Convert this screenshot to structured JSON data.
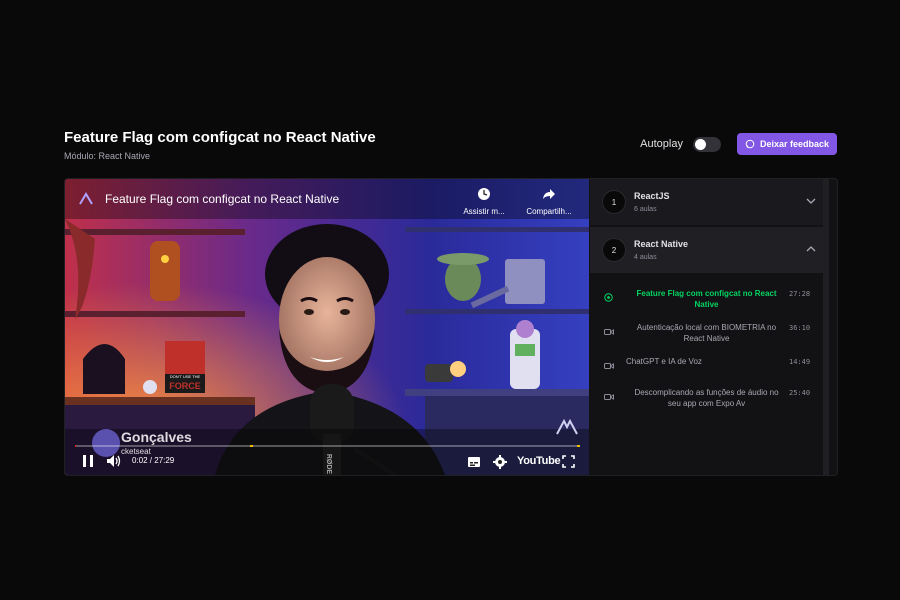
{
  "header": {
    "title": "Feature Flag com configcat no React Native",
    "subtitle": "Módulo: React Native",
    "autoplay_label": "Autoplay",
    "autoplay_on": false,
    "feedback_label": "Deixar feedback",
    "accent_color": "#8257e5"
  },
  "video": {
    "title": "Feature Flag com configcat no React Native",
    "watch_later_label": "Assistir m...",
    "share_label": "Compartilh...",
    "time_display": "0:02 / 27:29",
    "progress": 0.0012,
    "youtube_label": "YouTube",
    "presenter_name": "Gonçalves",
    "presenter_org": "cketseat",
    "poster_text_top": "DON'T USE THE",
    "poster_text_main": "FORCE",
    "mic_text": "RØDE"
  },
  "sidebar": {
    "modules": [
      {
        "number": "1",
        "title": "ReactJS",
        "count": "6 aulas",
        "expanded": false
      },
      {
        "number": "2",
        "title": "React Native",
        "count": "4 aulas",
        "expanded": true
      }
    ],
    "lessons": [
      {
        "title": "Feature Flag com configcat no React Native",
        "duration": "27:28",
        "active": true,
        "icon": "play-circle-icon"
      },
      {
        "title": "Autenticação local com BIOMETRIA no React Native",
        "duration": "36:10",
        "active": false,
        "icon": "video-icon"
      },
      {
        "title": "ChatGPT e IA de Voz",
        "duration": "14:49",
        "active": false,
        "icon": "video-icon"
      },
      {
        "title": "Descomplicando as funções de áudio no seu app com Expo Av",
        "duration": "25:40",
        "active": false,
        "icon": "video-icon"
      }
    ],
    "active_color": "#04d361"
  }
}
